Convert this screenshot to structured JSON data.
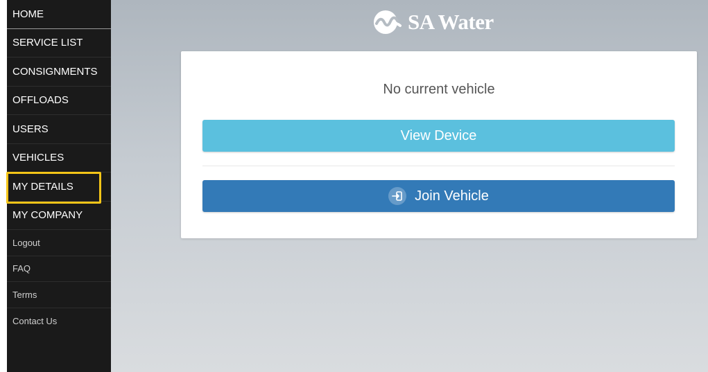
{
  "sidebar": {
    "items": [
      {
        "label": "HOME"
      },
      {
        "label": "SERVICE LIST"
      },
      {
        "label": "CONSIGNMENTS"
      },
      {
        "label": "OFFLOADS"
      },
      {
        "label": "USERS"
      },
      {
        "label": "VEHICLES"
      },
      {
        "label": "MY DETAILS"
      },
      {
        "label": "MY COMPANY"
      }
    ],
    "secondary": [
      {
        "label": "Logout"
      },
      {
        "label": "FAQ"
      },
      {
        "label": "Terms"
      },
      {
        "label": "Contact Us"
      }
    ],
    "highlight_color": "#f5c518"
  },
  "brand": {
    "name": "SA Water",
    "icon": "sa-water-logo"
  },
  "card": {
    "status": "No current vehicle",
    "view_device_label": "View Device",
    "join_vehicle_label": "Join Vehicle",
    "join_icon": "sign-in-icon"
  },
  "colors": {
    "view_button": "#5bc0de",
    "join_button": "#337ab7",
    "sidebar": "#1a1a1a"
  }
}
